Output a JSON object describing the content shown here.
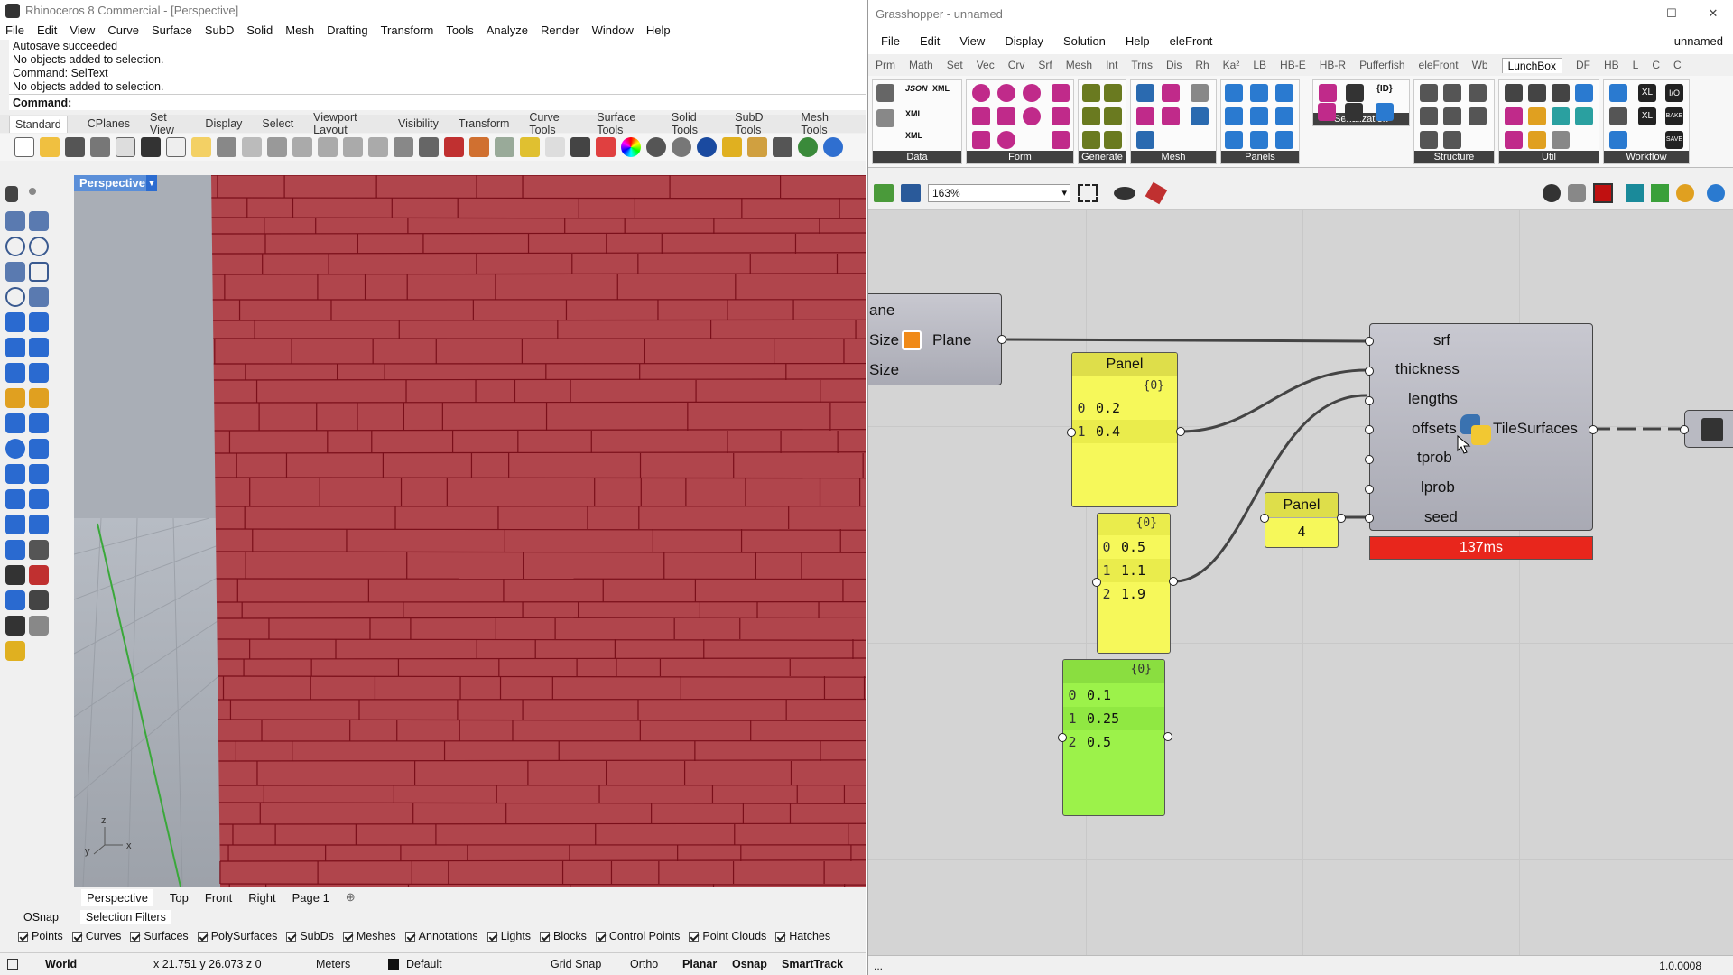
{
  "rhino": {
    "title": "Rhinoceros 8 Commercial - [Perspective]",
    "menu": [
      "File",
      "Edit",
      "View",
      "Curve",
      "Surface",
      "SubD",
      "Solid",
      "Mesh",
      "Drafting",
      "Transform",
      "Tools",
      "Analyze",
      "Render",
      "Window",
      "Help"
    ],
    "history": [
      "Autosave succeeded",
      "No objects added to selection.",
      "Command: SelText",
      "No objects added to selection."
    ],
    "command_prompt": "Command:",
    "toolbar_tabs": [
      "Standard",
      "CPlanes",
      "Set View",
      "Display",
      "Select",
      "Viewport Layout",
      "Visibility",
      "Transform",
      "Curve Tools",
      "Surface Tools",
      "Solid Tools",
      "SubD Tools",
      "Mesh Tools"
    ],
    "active_toolbar_tab": "Standard",
    "viewport_title": "Perspective",
    "viewport_axes": {
      "z": "z",
      "y": "y",
      "x": "x"
    },
    "viewport_tabs": [
      "Perspective",
      "Top",
      "Front",
      "Right",
      "Page 1"
    ],
    "panel_tabs": [
      "OSnap",
      "Selection Filters"
    ],
    "filters": [
      "Points",
      "Curves",
      "Surfaces",
      "PolySurfaces",
      "SubDs",
      "Meshes",
      "Annotations",
      "Lights",
      "Blocks",
      "Control Points",
      "Point Clouds",
      "Hatches"
    ],
    "status": {
      "cplane": "World",
      "coords": "x 21.751   y 26.073   z 0",
      "units": "Meters",
      "layer": "Default",
      "toggles": [
        "Grid Snap",
        "Ortho",
        "Planar",
        "Osnap",
        "SmartTrack"
      ]
    },
    "colors": {
      "wall": "#b0454c",
      "tile_line": "#7a0f1a",
      "viewport_bg": "#a9aeb6",
      "viewport_tab": "#5b8fd9"
    }
  },
  "gh": {
    "title": "Grasshopper - unnamed",
    "window_controls": [
      "—",
      "☐",
      "✕"
    ],
    "menu": [
      "File",
      "Edit",
      "View",
      "Display",
      "Solution",
      "Help",
      "eleFront"
    ],
    "doc_name": "unnamed",
    "tabs": [
      "Prm",
      "Math",
      "Set",
      "Vec",
      "Crv",
      "Srf",
      "Mesh",
      "Int",
      "Trns",
      "Dis",
      "Rh",
      "Ka²",
      "LB",
      "HB-E",
      "HB-R",
      "Pufferfish",
      "eleFront",
      "Wb",
      "LunchBox",
      "DF",
      "HB",
      "L",
      "C",
      "C"
    ],
    "active_tab": "LunchBox",
    "ribbon_groups": [
      "Data",
      "Form",
      "Generate",
      "Mesh",
      "Panels",
      "Serialization",
      "Structure",
      "Util",
      "Workflow"
    ],
    "ribbon_icon_text": {
      "json": "JSON",
      "xml": "XML",
      "id": "{ID}",
      "xl": "XL",
      "io": "I/O",
      "bake": "BAKE",
      "save": "SAVE"
    },
    "zoom": "163%",
    "canvas": {
      "plane_node": {
        "inputs": [
          "ane",
          "Size",
          "Size"
        ],
        "output": "Plane"
      },
      "panel_a": {
        "title": "Panel",
        "branch": "{0}",
        "items": [
          [
            "0",
            "0.2"
          ],
          [
            "1",
            "0.4"
          ]
        ]
      },
      "panel_b": {
        "branch": "{0}",
        "items": [
          [
            "0",
            "0.5"
          ],
          [
            "1",
            "1.1"
          ],
          [
            "2",
            "1.9"
          ]
        ]
      },
      "panel_c": {
        "branch": "{0}",
        "items": [
          [
            "0",
            "0.1"
          ],
          [
            "1",
            "0.25"
          ],
          [
            "2",
            "0.5"
          ]
        ]
      },
      "panel_d": {
        "title": "Panel",
        "value": "4"
      },
      "tile_node": {
        "name": "TileSurfaces",
        "inputs": [
          "srf",
          "thickness",
          "lengths",
          "offsets",
          "tprob",
          "lprob",
          "seed"
        ],
        "timing": "137ms"
      }
    },
    "status_left": "...",
    "status_right": "1.0.0008",
    "colors": {
      "canvas": "#d4d4d4",
      "panel_yellow": "#f6f85a",
      "panel_green": "#9cf24a",
      "timing_red": "#e8261c"
    }
  }
}
